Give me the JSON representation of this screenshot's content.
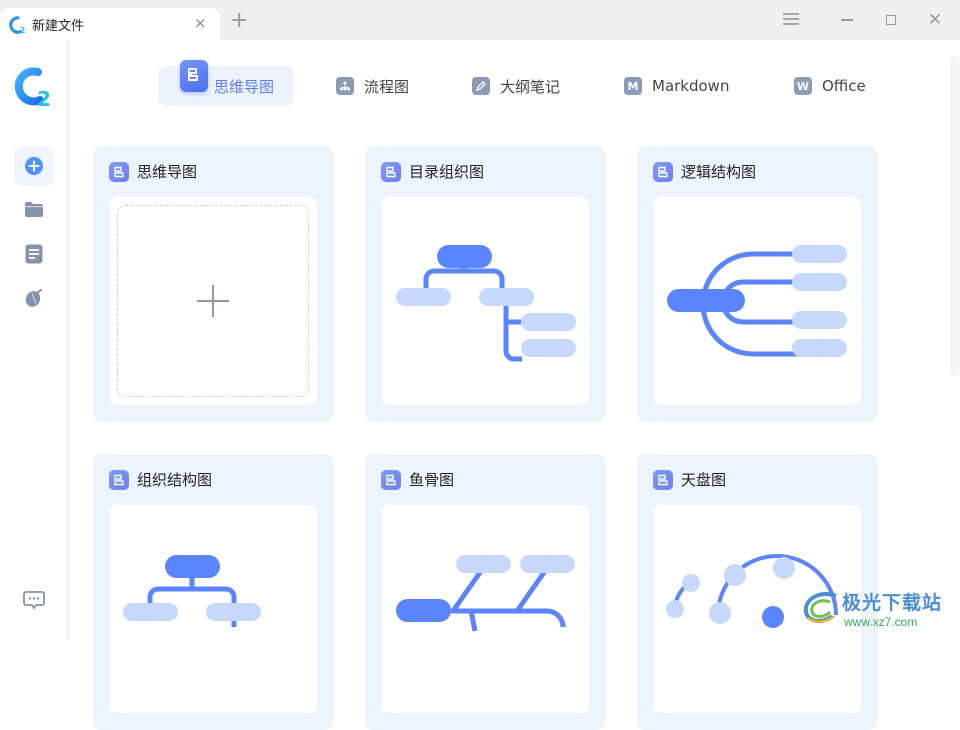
{
  "window": {
    "tab_title": "新建文件",
    "tab_close_icon": "×",
    "new_tab_icon": "+",
    "close_icon": "✕"
  },
  "sidebar": {
    "items": [
      {
        "name": "new-file",
        "icon": "plus-circle-icon",
        "active": true
      },
      {
        "name": "folder",
        "icon": "folder-icon"
      },
      {
        "name": "document",
        "icon": "document-icon"
      },
      {
        "name": "acorn",
        "icon": "acorn-icon"
      }
    ],
    "bottom": {
      "name": "feedback",
      "icon": "chat-icon"
    }
  },
  "topnav": {
    "items": [
      {
        "label": "思维导图",
        "icon": "mindmap-icon",
        "active": true
      },
      {
        "label": "流程图",
        "icon": "flowchart-icon"
      },
      {
        "label": "大纲笔记",
        "icon": "pen-icon"
      },
      {
        "label": "Markdown",
        "icon": "M"
      },
      {
        "label": "Office",
        "icon": "W"
      }
    ]
  },
  "templates": [
    {
      "title": "思维导图",
      "preview": "blank"
    },
    {
      "title": "目录组织图",
      "preview": "directory-tree"
    },
    {
      "title": "逻辑结构图",
      "preview": "logic-structure"
    },
    {
      "title": "组织结构图",
      "preview": "org-chart"
    },
    {
      "title": "鱼骨图",
      "preview": "fishbone"
    },
    {
      "title": "天盘图",
      "preview": "radial"
    }
  ],
  "watermark": {
    "line1": "极光下载站",
    "line2": "www.xz7.com"
  },
  "colors": {
    "accent": "#5b7ef5",
    "node_primary": "#5b84ff",
    "node_secondary": "#c6d9fc",
    "card_bg": "#edf4fe"
  }
}
